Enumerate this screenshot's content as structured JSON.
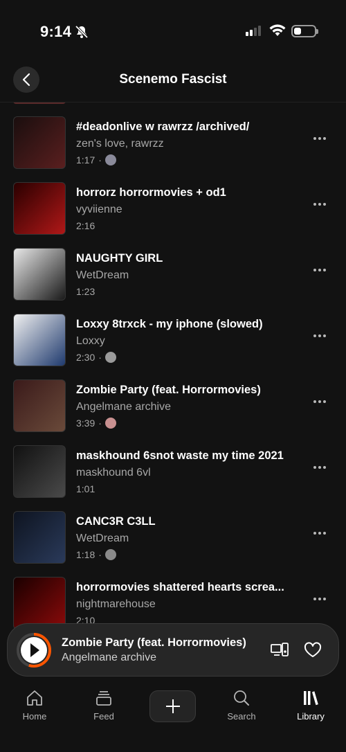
{
  "status_bar": {
    "time": "9:14",
    "battery_level": 0.35
  },
  "header": {
    "title": "Scenemo Fascist",
    "back_icon": "chevron-left-icon"
  },
  "tracks": [
    {
      "title": "#deadonlive w rawrzz /archived/",
      "artist": "zen's love, rawrzz",
      "duration": "1:17",
      "meta_sep": "·",
      "has_avatar": true,
      "avatar_color": "#8a8a9a",
      "cover_colors": [
        "#1a0e0e",
        "#5a1f1f"
      ]
    },
    {
      "title": "horrorz horrormovies + od1",
      "artist": "vyviienne",
      "duration": "2:16",
      "meta_sep": "",
      "has_avatar": false,
      "cover_colors": [
        "#2a0000",
        "#b01818"
      ]
    },
    {
      "title": "NAUGHTY GIRL",
      "artist": "WetDream",
      "duration": "1:23",
      "meta_sep": "",
      "has_avatar": false,
      "cover_colors": [
        "#e8e8e8",
        "#1a1a1a"
      ]
    },
    {
      "title": "Loxxy  8trxck - my iphone (slowed)",
      "artist": "Loxxy",
      "duration": "2:30",
      "meta_sep": "·",
      "has_avatar": true,
      "avatar_color": "#9a9a9a",
      "cover_colors": [
        "#f0f0f0",
        "#1f3a6e"
      ]
    },
    {
      "title": "Zombie Party (feat. Horrormovies)",
      "artist": "Angelmane archive",
      "duration": "3:39",
      "meta_sep": "·",
      "has_avatar": true,
      "avatar_color": "#c89090",
      "cover_colors": [
        "#3a1a1a",
        "#6a4a3a"
      ]
    },
    {
      "title": "maskhound 6snot waste my time 2021",
      "artist": "maskhound 6vl",
      "duration": "1:01",
      "meta_sep": "",
      "has_avatar": false,
      "cover_colors": [
        "#111111",
        "#4a4a4a"
      ]
    },
    {
      "title": "CANC3R C3LL",
      "artist": "WetDream",
      "duration": "1:18",
      "meta_sep": "·",
      "has_avatar": true,
      "avatar_color": "#8a8a8a",
      "cover_colors": [
        "#0e1420",
        "#2a3a5a"
      ]
    },
    {
      "title": "horrormovies shattered hearts screa...",
      "artist": "nightmarehouse",
      "duration": "2:10",
      "meta_sep": "",
      "has_avatar": false,
      "cover_colors": [
        "#1a0000",
        "#8a0a0a"
      ]
    }
  ],
  "now_playing": {
    "title": "Zombie Party (feat. Horrormovies)",
    "artist": "Angelmane archive",
    "progress": 0.55,
    "accent_color": "#ff5500"
  },
  "tabs": [
    {
      "label": "Home",
      "icon": "home-icon",
      "active": false
    },
    {
      "label": "Feed",
      "icon": "feed-icon",
      "active": false
    },
    {
      "label": "",
      "icon": "plus-icon",
      "active": false
    },
    {
      "label": "Search",
      "icon": "search-icon",
      "active": false
    },
    {
      "label": "Library",
      "icon": "library-icon",
      "active": true
    }
  ]
}
